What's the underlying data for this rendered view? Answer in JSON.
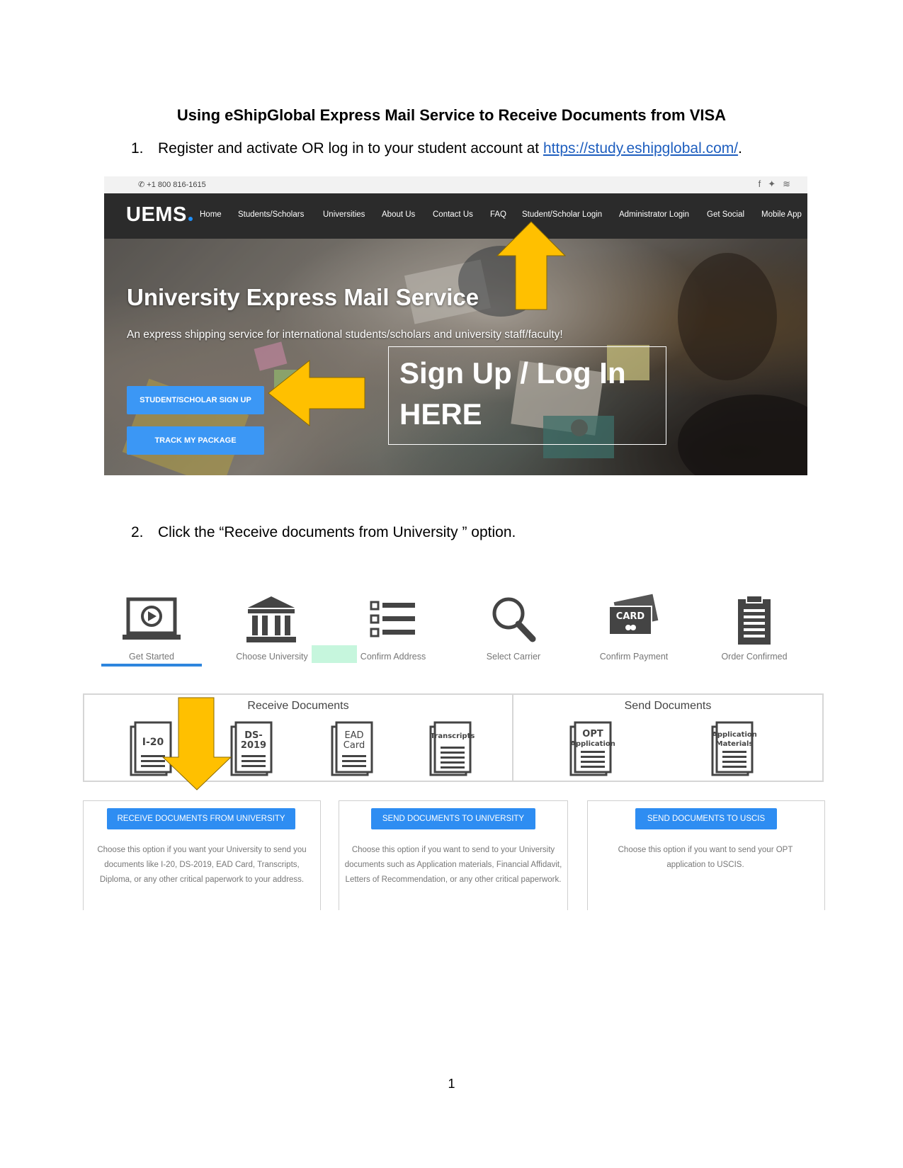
{
  "document": {
    "title": "Using eShipGlobal Express Mail Service to Receive Documents from VISA",
    "page_number": "1"
  },
  "step1": {
    "number": "1.",
    "text": "Register and activate OR log in to your student account at ",
    "link": "https://study.eshipglobal.com/",
    "suffix": "."
  },
  "step2": {
    "number": "2.",
    "text": "Click the “Receive documents from University ” option."
  },
  "site": {
    "phone": "+1 800 816-1615",
    "social_icons": [
      "facebook-icon",
      "twitter-icon",
      "rss-icon"
    ],
    "logo": "UEMS",
    "nav": [
      "Home",
      "Students/Scholars",
      "Universities",
      "About Us",
      "Contact Us",
      "FAQ",
      "Student/Scholar Login",
      "Administrator Login",
      "Get Social",
      "Mobile App"
    ],
    "hero_title": "University Express Mail Service",
    "hero_subtitle": "An express shipping service for international students/scholars and university staff/faculty!",
    "signup_button": "STUDENT/SCHOLAR SIGN UP",
    "track_button": "TRACK MY PACKAGE",
    "callout_line1": "Sign Up / Log In",
    "callout_line2": "HERE"
  },
  "progress": {
    "steps": [
      {
        "label": "Get Started",
        "icon": "laptop-play-icon"
      },
      {
        "label": "Choose University",
        "icon": "university-icon"
      },
      {
        "label": "Confirm Address",
        "icon": "list-icon"
      },
      {
        "label": "Select Carrier",
        "icon": "search-icon"
      },
      {
        "label": "Confirm Payment",
        "icon": "card-icon"
      },
      {
        "label": "Order Confirmed",
        "icon": "clipboard-icon"
      }
    ],
    "active_color": "#2e86de"
  },
  "receive": {
    "title": "Receive Documents",
    "docs": [
      "I-20",
      "DS-\n2019",
      "EAD\nCard",
      "Transcripts"
    ]
  },
  "send": {
    "title": "Send Documents",
    "docs": [
      "OPT\nApplication",
      "Application\nMaterials"
    ]
  },
  "options": [
    {
      "button": "RECEIVE DOCUMENTS FROM UNIVERSITY",
      "description": "Choose this option if you want your University to send you documents like I-20, DS-2019, EAD Card, Transcripts, Diploma, or any other critical paperwork to your address."
    },
    {
      "button": "SEND DOCUMENTS TO UNIVERSITY",
      "description": "Choose this option if you want to send to your University documents such as Application materials, Financial Affidavit, Letters of Recommendation, or any other critical paperwork."
    },
    {
      "button": "SEND DOCUMENTS TO USCIS",
      "description": "Choose this option if you want to send your OPT application to USCIS."
    }
  ],
  "colors": {
    "button_blue": "#3b97f5",
    "arrow_yellow": "#ffc000",
    "nav_dark": "#2b2b2b"
  }
}
